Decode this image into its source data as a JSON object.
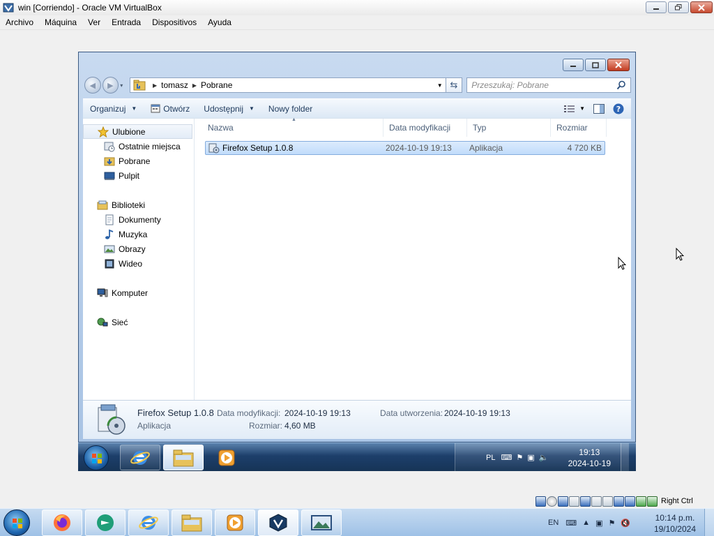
{
  "vbox": {
    "title": "win [Corriendo] - Oracle VM VirtualBox",
    "menu": [
      "Archivo",
      "Máquina",
      "Ver",
      "Entrada",
      "Dispositivos",
      "Ayuda"
    ],
    "host_key": "Right Ctrl"
  },
  "explorer": {
    "breadcrumb": [
      "tomasz",
      "Pobrane"
    ],
    "search_placeholder": "Przeszukaj: Pobrane",
    "toolbar": {
      "organize": "Organizuj",
      "open": "Otwórz",
      "share": "Udostępnij",
      "new_folder": "Nowy folder"
    },
    "nav": {
      "favorites": "Ulubione",
      "favorites_items": [
        "Ostatnie miejsca",
        "Pobrane",
        "Pulpit"
      ],
      "libraries": "Biblioteki",
      "libraries_items": [
        "Dokumenty",
        "Muzyka",
        "Obrazy",
        "Wideo"
      ],
      "computer": "Komputer",
      "network": "Sieć"
    },
    "columns": [
      "Nazwa",
      "Data modyfikacji",
      "Typ",
      "Rozmiar"
    ],
    "files": [
      {
        "name": "Firefox Setup 1.0.8",
        "modified": "2024-10-19 19:13",
        "type": "Aplikacja",
        "size": "4 720 KB"
      }
    ],
    "details": {
      "name": "Firefox Setup 1.0.8",
      "type": "Aplikacja",
      "modified_label": "Data modyfikacji:",
      "modified_value": "2024-10-19 19:13",
      "size_label": "Rozmiar:",
      "size_value": "4,60 MB",
      "created_label": "Data utworzenia:",
      "created_value": "2024-10-19 19:13"
    }
  },
  "guest_taskbar": {
    "lang": "PL",
    "time": "19:13",
    "date": "2024-10-19"
  },
  "host_taskbar": {
    "lang": "EN",
    "time": "10:14 p.m.",
    "date": "19/10/2024"
  },
  "colors": {
    "selection": "#c1dcfb",
    "taskbar_guest": "#1d3f6b",
    "taskbar_host": "#9ec1e6"
  }
}
